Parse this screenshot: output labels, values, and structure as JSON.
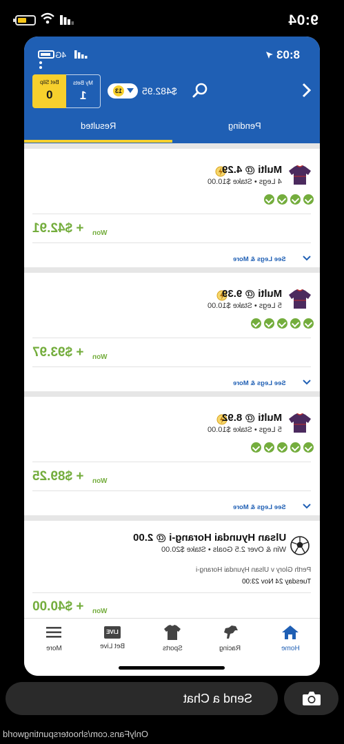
{
  "outer_status": {
    "time": "9:04"
  },
  "inner_status": {
    "time": "8:03",
    "network": "4G"
  },
  "header": {
    "bet_slip_label": "Bet Slip",
    "bet_slip_count": "0",
    "my_bets_label": "My Bets",
    "my_bets_count": "1",
    "badge_count": "13",
    "balance": "$482.95"
  },
  "tabs": {
    "pending": "Pending",
    "resulted": "Resulted",
    "active": "Resulted"
  },
  "bets": [
    {
      "title": "Multi @ 4.29",
      "subtitle": "4 Legs • Stake $10.00",
      "legs_won": 4,
      "won_label": "Won",
      "won_amount": "+ $42.91",
      "see_more": "See Legs & More"
    },
    {
      "title": "Multi @ 9.39",
      "subtitle": "5 Legs • Stake $10.00",
      "legs_won": 5,
      "won_label": "Won",
      "won_amount": "+ $93.97",
      "see_more": "See Legs & More"
    },
    {
      "title": "Multi @ 8.92",
      "subtitle": "5 Legs • Stake $10.00",
      "legs_won": 5,
      "won_label": "Won",
      "won_amount": "+ $89.25",
      "see_more": "See Legs & More"
    },
    {
      "title": "Ulsan Hyundai Horang-i @ 2.00",
      "subtitle": "Win & Over 2.5 Goals • Stake $20.00",
      "event": "Perth Glory v Ulsan Hyundai Horang-i",
      "date": "Tuesday 24 Nov 23:00",
      "won_label": "Won",
      "won_amount": "+ $40.00"
    }
  ],
  "nav": {
    "home": "Home",
    "racing": "Racing",
    "sports": "Sports",
    "bet_live": "Bet Live",
    "more": "More",
    "live_icon_text": "LIVE"
  },
  "chat": {
    "placeholder": "Send a Chat"
  },
  "watermark": "OnlyFans.com/shooterspuntingworld",
  "colors": {
    "brand_blue": "#1f5fb4",
    "accent_yellow": "#f7d02d",
    "win_green": "#74ad3d"
  }
}
